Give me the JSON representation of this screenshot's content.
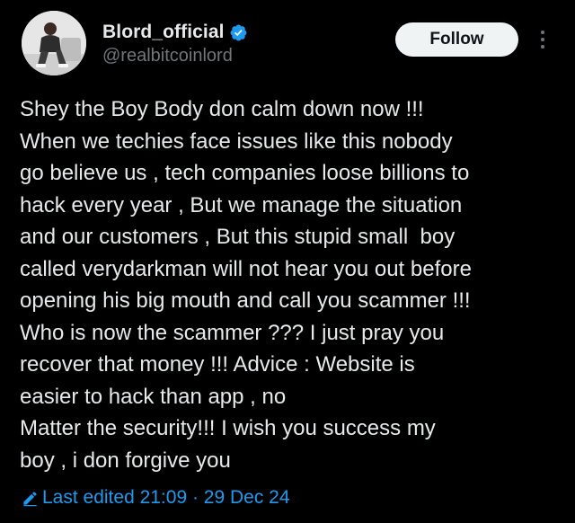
{
  "author": {
    "display_name": "Blord_official",
    "handle": "@realbitcoinlord",
    "verified": true,
    "avatar_icon": "profile-photo"
  },
  "actions": {
    "follow_label": "Follow",
    "more_icon": "more-vertical-icon"
  },
  "tweet": {
    "lines": [
      "Shey the Boy Body don calm down now !!!",
      "When we techies face issues like this nobody",
      "go believe us , tech companies loose billions to",
      "hack every year , But we manage the situation",
      "and our customers , But this stupid small  boy",
      "called verydarkman will not hear you out before",
      "opening his big mouth and call you scammer !!!",
      "Who is now the scammer ??? I just pray you",
      "recover that money !!! Advice : Website is",
      "easier to hack than app , no",
      "Matter the security!!! I wish you success my",
      "boy , i don forgive you"
    ],
    "edited_label": "Last edited 21:09 · 29 Dec 24"
  },
  "colors": {
    "background": "#000000",
    "text": "#e7e9ea",
    "secondary_text": "#71767b",
    "accent": "#1d9bf0",
    "follow_bg": "#eff3f4"
  }
}
